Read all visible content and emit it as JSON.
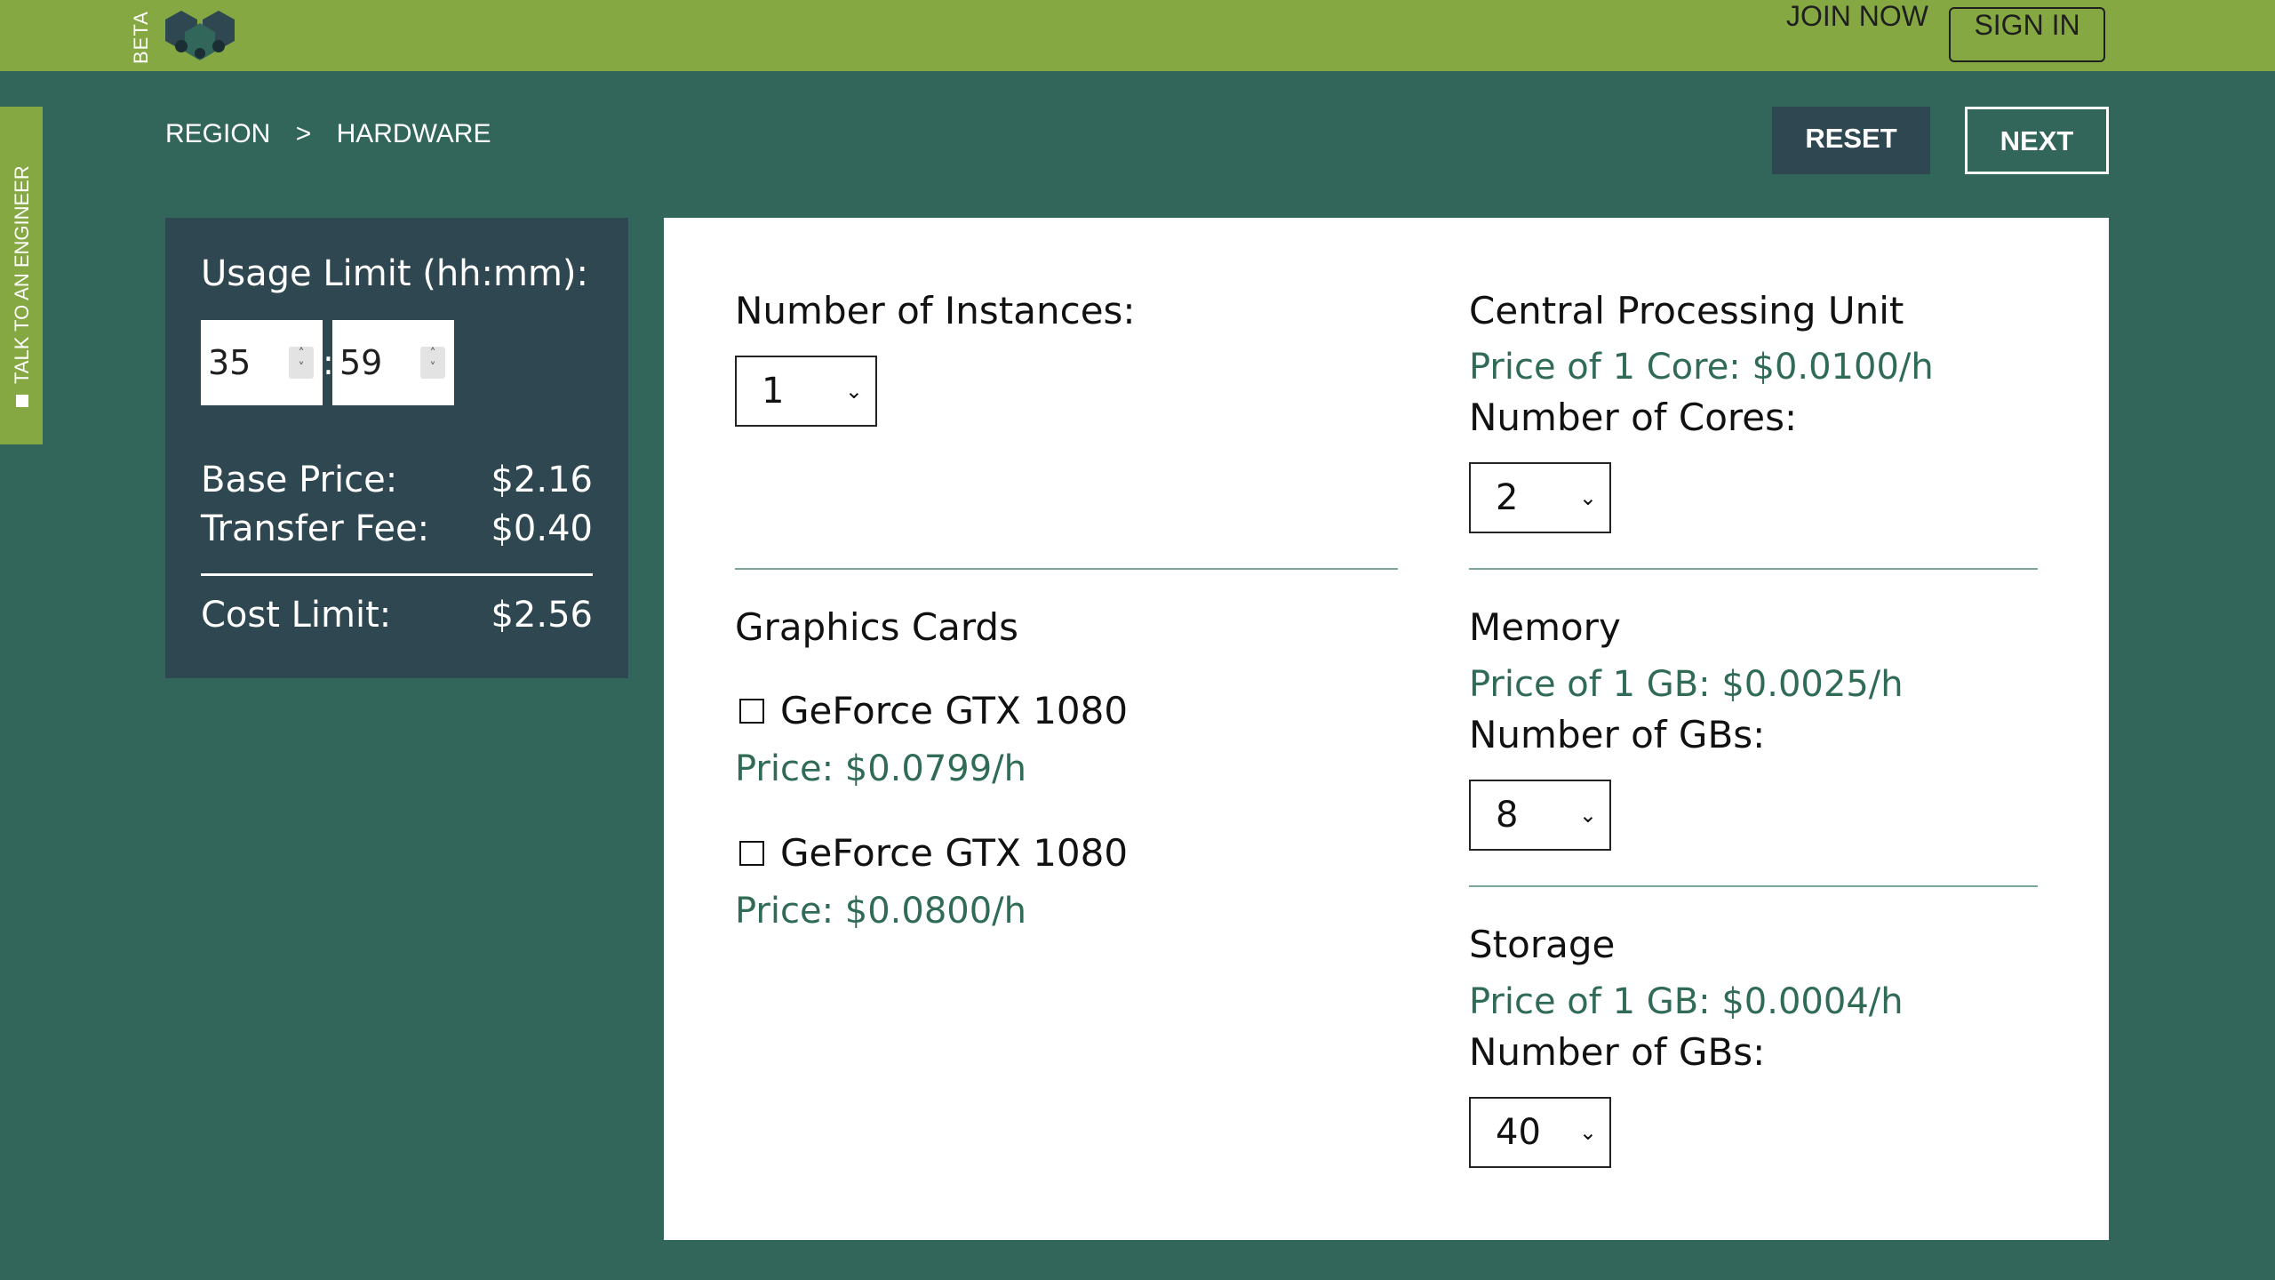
{
  "header": {
    "beta": "BETA",
    "join_now": "JOIN NOW",
    "sign_in": "SIGN IN"
  },
  "side_tab": {
    "label": "TALK TO AN ENGINEER"
  },
  "breadcrumb": {
    "items": [
      "REGION",
      ">",
      "HARDWARE"
    ]
  },
  "actions": {
    "reset": "RESET",
    "next": "NEXT"
  },
  "summary": {
    "title": "Usage Limit (hh:mm):",
    "hours": "35",
    "minutes": "59",
    "colon": ":",
    "base_price_label": "Base Price:",
    "base_price": "$2.16",
    "transfer_fee_label": "Transfer Fee:",
    "transfer_fee": "$0.40",
    "cost_limit_label": "Cost Limit:",
    "cost_limit": "$2.56"
  },
  "instances": {
    "label": "Number of Instances:",
    "value": "1"
  },
  "cpu": {
    "title": "Central Processing Unit",
    "price": "Price of 1 Core: $0.0100/h",
    "count_label": "Number of Cores:",
    "value": "2"
  },
  "gpu": {
    "title": "Graphics Cards",
    "cards": [
      {
        "name": "GeForce GTX 1080",
        "price": "Price: $0.0799/h"
      },
      {
        "name": "GeForce GTX 1080",
        "price": "Price: $0.0800/h"
      }
    ]
  },
  "memory": {
    "title": "Memory",
    "price": "Price of 1 GB: $0.0025/h",
    "count_label": "Number of GBs:",
    "value": "8"
  },
  "storage": {
    "title": "Storage",
    "price": "Price of 1 GB: $0.0004/h",
    "count_label": "Number of GBs:",
    "value": "40"
  },
  "colors": {
    "header": "#85a842",
    "background": "#33665a",
    "panel_dark": "#2e4750",
    "price_text": "#2f6b55"
  }
}
